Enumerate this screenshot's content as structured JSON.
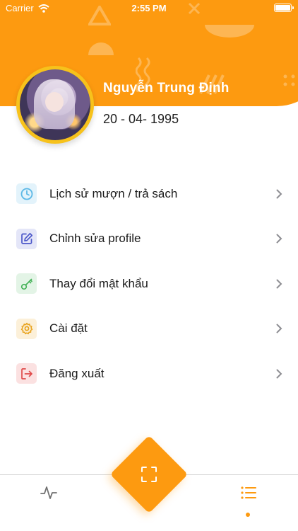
{
  "status_bar": {
    "carrier": "Carrier",
    "time": "2:55 PM"
  },
  "profile": {
    "name": "Nguyễn Trung Định",
    "dob": "20 - 04- 1995"
  },
  "menu": {
    "items": [
      {
        "label": "Lịch sử mượn / trả sách",
        "icon": "clock-icon",
        "icon_color": "#5cb8e6",
        "icon_bg": "#e3f3fb"
      },
      {
        "label": "Chỉnh sửa profile",
        "icon": "edit-icon",
        "icon_color": "#4b57c9",
        "icon_bg": "#e4e6f8"
      },
      {
        "label": "Thay đổi mật khẩu",
        "icon": "key-icon",
        "icon_color": "#47b35a",
        "icon_bg": "#e3f4e6"
      },
      {
        "label": "Cài đặt",
        "icon": "gear-icon",
        "icon_color": "#e8a21c",
        "icon_bg": "#fcf0d9"
      },
      {
        "label": "Đăng xuất",
        "icon": "logout-icon",
        "icon_color": "#e04a4a",
        "icon_bg": "#fbe1e1"
      }
    ]
  },
  "tabbar": {
    "tabs": [
      {
        "icon": "activity-icon",
        "active": false
      },
      {
        "icon": "scan-icon",
        "active": false
      },
      {
        "icon": "list-icon",
        "active": true
      }
    ]
  },
  "colors": {
    "accent": "#fd9a10",
    "avatar_ring": "#f7c21b"
  }
}
